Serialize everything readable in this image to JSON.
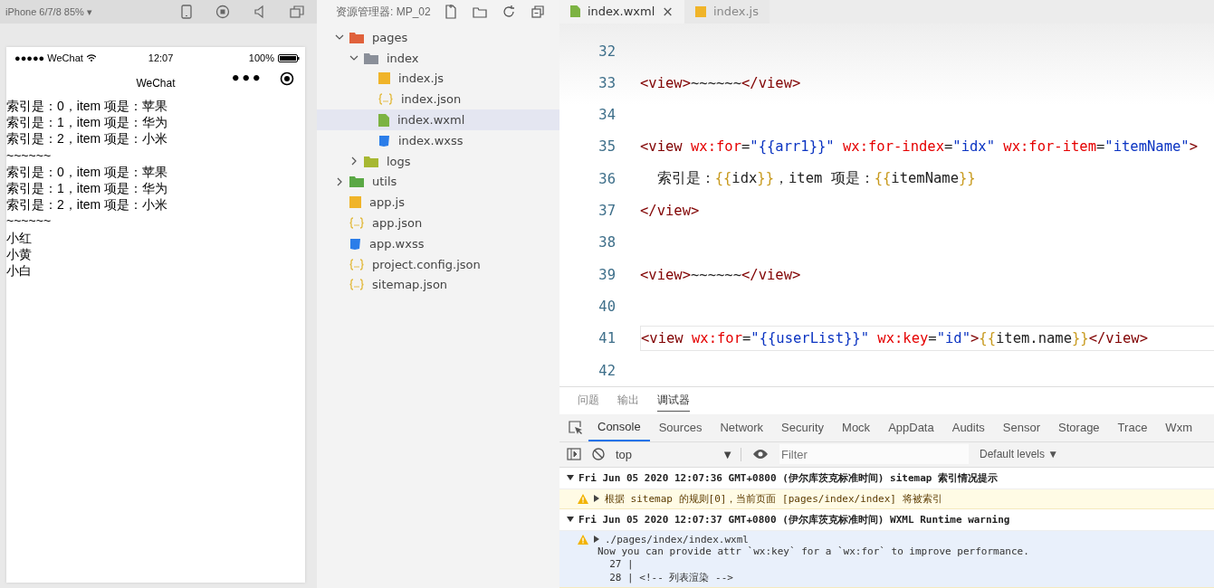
{
  "simulator": {
    "device": "iPhone 6/7/8 85%",
    "caret": "▾",
    "status_bar": {
      "carrier": "●●●●● WeChat",
      "time": "12:07",
      "battery": "100%"
    },
    "nav_title": "WeChat",
    "capsule_menu": "•••",
    "lines": [
      "索引是：0，item 项是：苹果",
      "索引是：1，item 项是：华为",
      "索引是：2，item 项是：小米",
      "~~~~~~",
      "索引是：0，item 项是：苹果",
      "索引是：1，item 项是：华为",
      "索引是：2，item 项是：小米",
      "~~~~~~",
      "小红",
      "小黄",
      "小白"
    ]
  },
  "explorer": {
    "title": "资源管理器: MP_02",
    "tree": [
      {
        "name": "pages",
        "kind": "folder-pages",
        "expanded": true,
        "selected": false,
        "children": [
          {
            "name": "index",
            "kind": "folder",
            "expanded": true,
            "selected": false,
            "children": [
              {
                "name": "index.js",
                "kind": "js",
                "selected": false
              },
              {
                "name": "index.json",
                "kind": "json",
                "selected": false
              },
              {
                "name": "index.wxml",
                "kind": "wxml",
                "selected": true
              },
              {
                "name": "index.wxss",
                "kind": "wxss",
                "selected": false
              }
            ]
          },
          {
            "name": "logs",
            "kind": "folder-logs",
            "expanded": false,
            "selected": false
          }
        ]
      },
      {
        "name": "utils",
        "kind": "folder-utils",
        "expanded": false,
        "selected": false
      },
      {
        "name": "app.js",
        "kind": "js",
        "selected": false
      },
      {
        "name": "app.json",
        "kind": "json",
        "selected": false
      },
      {
        "name": "app.wxss",
        "kind": "wxss",
        "selected": false
      },
      {
        "name": "project.config.json",
        "kind": "json",
        "selected": false
      },
      {
        "name": "sitemap.json",
        "kind": "json",
        "selected": false
      }
    ]
  },
  "editor": {
    "tabs": [
      {
        "label": "index.wxml",
        "kind": "wxml",
        "selected": true,
        "close": "×"
      },
      {
        "label": "index.js",
        "kind": "js",
        "selected": false
      }
    ],
    "lines": [
      {
        "number": "32",
        "current": false
      },
      {
        "number": "33",
        "current": false,
        "tokens": [
          {
            "kind": "tag",
            "t": "<view>"
          },
          {
            "kind": "text",
            "t": "~~~~~~"
          },
          {
            "kind": "tag",
            "t": "</view>"
          }
        ]
      },
      {
        "number": "34",
        "current": false
      },
      {
        "number": "35",
        "current": false,
        "tokens": [
          {
            "kind": "tag",
            "t": "<view "
          },
          {
            "kind": "attr",
            "t": "wx:for"
          },
          {
            "kind": "text",
            "t": "="
          },
          {
            "kind": "str",
            "t": "\"{{arr1}}\" "
          },
          {
            "kind": "attr",
            "t": "wx:for-index"
          },
          {
            "kind": "text",
            "t": "="
          },
          {
            "kind": "str",
            "t": "\"idx\" "
          },
          {
            "kind": "attr",
            "t": "wx:for-item"
          },
          {
            "kind": "text",
            "t": "="
          },
          {
            "kind": "str",
            "t": "\"itemName\""
          },
          {
            "kind": "tag",
            "t": ">"
          }
        ]
      },
      {
        "number": "36",
        "current": false,
        "tokens": [
          {
            "kind": "text",
            "t": "  索引是："
          },
          {
            "kind": "brace",
            "t": "{{"
          },
          {
            "kind": "text",
            "t": "idx"
          },
          {
            "kind": "brace",
            "t": "}}"
          },
          {
            "kind": "text",
            "t": "，item 项是："
          },
          {
            "kind": "brace",
            "t": "{{"
          },
          {
            "kind": "text",
            "t": "itemName"
          },
          {
            "kind": "brace",
            "t": "}}"
          }
        ]
      },
      {
        "number": "37",
        "current": false,
        "tokens": [
          {
            "kind": "tag",
            "t": "</view>"
          }
        ]
      },
      {
        "number": "38",
        "current": false
      },
      {
        "number": "39",
        "current": false,
        "tokens": [
          {
            "kind": "tag",
            "t": "<view>"
          },
          {
            "kind": "text",
            "t": "~~~~~~"
          },
          {
            "kind": "tag",
            "t": "</view>"
          }
        ]
      },
      {
        "number": "40",
        "current": false
      },
      {
        "number": "41",
        "current": true,
        "tokens": [
          {
            "kind": "tag",
            "t": "<view "
          },
          {
            "kind": "attr",
            "t": "wx:for"
          },
          {
            "kind": "text",
            "t": "="
          },
          {
            "kind": "str",
            "t": "\"{{userList}}\" "
          },
          {
            "kind": "attr",
            "t": "wx:key"
          },
          {
            "kind": "text",
            "t": "="
          },
          {
            "kind": "str",
            "t": "\"id\""
          },
          {
            "kind": "tag",
            "t": ">"
          },
          {
            "kind": "brace",
            "t": "{{"
          },
          {
            "kind": "text",
            "t": "item.name"
          },
          {
            "kind": "brace",
            "t": "}}"
          },
          {
            "kind": "tag",
            "t": "</view>"
          }
        ]
      },
      {
        "number": "42",
        "current": false
      }
    ]
  },
  "panel": {
    "tabs": [
      {
        "label": "问题",
        "selected": false
      },
      {
        "label": "输出",
        "selected": false
      },
      {
        "label": "调试器",
        "selected": true
      }
    ],
    "devtools_tabs": [
      {
        "label": "Console",
        "selected": true
      },
      {
        "label": "Sources",
        "selected": false
      },
      {
        "label": "Network",
        "selected": false
      },
      {
        "label": "Security",
        "selected": false
      },
      {
        "label": "Mock",
        "selected": false
      },
      {
        "label": "AppData",
        "selected": false
      },
      {
        "label": "Audits",
        "selected": false
      },
      {
        "label": "Sensor",
        "selected": false
      },
      {
        "label": "Storage",
        "selected": false
      },
      {
        "label": "Trace",
        "selected": false
      },
      {
        "label": "Wxm",
        "selected": false
      }
    ],
    "context": "top",
    "context_caret": "▼",
    "filter": {
      "placeholder": "Filter"
    },
    "levels": "Default levels ▼",
    "messages": [
      {
        "kind": "group",
        "expanded": true,
        "text": "Fri Jun 05 2020 12:07:36 GMT+0800 (伊尔库茨克标准时间) sitemap 索引情况提示"
      },
      {
        "kind": "warning",
        "text": "根据 sitemap 的规则[0]，当前页面 [pages/index/index] 将被索引"
      },
      {
        "kind": "group",
        "expanded": true,
        "text": "Fri Jun 05 2020 12:07:37 GMT+0800 (伊尔库茨克标准时间) WXML Runtime warning"
      },
      {
        "kind": "warning",
        "text": "./pages/index/index.wxml",
        "details": [
          "Now you can provide attr `wx:key` for a `wx:for` to improve performance.",
          "  27 |",
          "  28 | <!-- 列表渲染 -->"
        ]
      }
    ]
  }
}
